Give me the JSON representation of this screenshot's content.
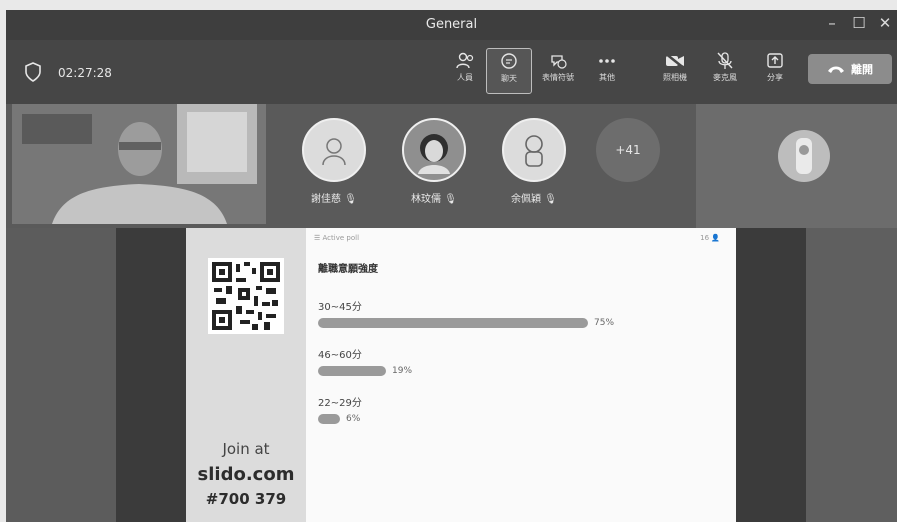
{
  "window": {
    "title": "General",
    "controls": {
      "minimize": "–",
      "maximize": "☐",
      "close": "✕"
    }
  },
  "toolbar": {
    "timer": "02:27:28",
    "buttons": [
      {
        "icon": "people-icon",
        "label": "人員"
      },
      {
        "icon": "chat-icon",
        "label": "聊天"
      },
      {
        "icon": "reactions-icon",
        "label": "表情符號"
      },
      {
        "icon": "more-icon",
        "label": "其他"
      },
      {
        "icon": "camera-off-icon",
        "label": "照相機"
      },
      {
        "icon": "mic-off-icon",
        "label": "麥克風"
      },
      {
        "icon": "share-icon",
        "label": "分享"
      }
    ],
    "leave_label": "離開"
  },
  "participants": [
    {
      "name": "謝佳慈"
    },
    {
      "name": "林玟儒"
    },
    {
      "name": "余佩穎"
    }
  ],
  "more_count": "+41",
  "slido": {
    "join_at": "Join at",
    "site": "slido.com",
    "code": "#700 379"
  },
  "poll": {
    "status": "Active poll",
    "votes": "16",
    "question": "離職意願強度",
    "options": [
      {
        "label": "30~45分",
        "percent": 75,
        "display": "75%"
      },
      {
        "label": "46~60分",
        "percent": 19,
        "display": "19%"
      },
      {
        "label": "22~29分",
        "percent": 6,
        "display": "6%"
      }
    ]
  }
}
